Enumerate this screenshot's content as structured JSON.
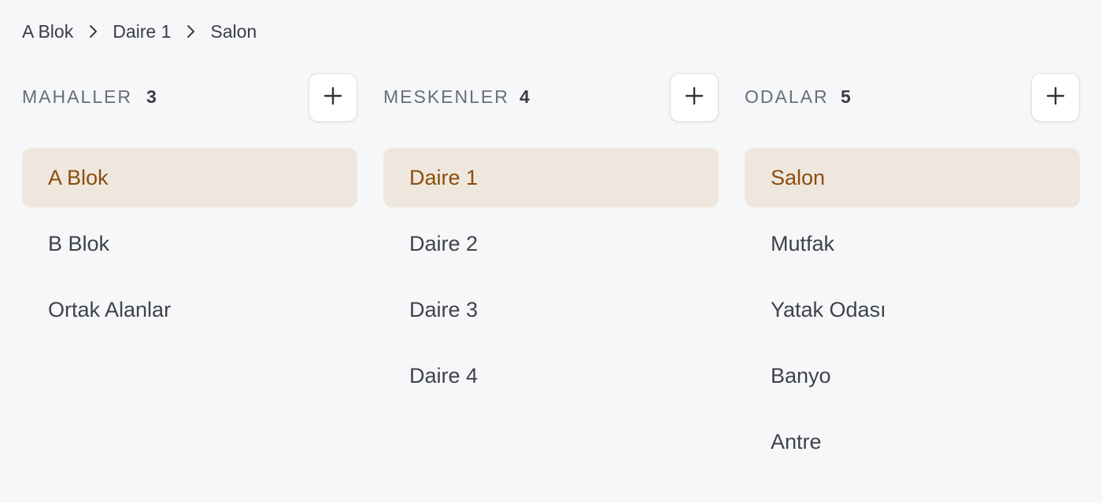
{
  "breadcrumb": [
    "A Blok",
    "Daire 1",
    "Salon"
  ],
  "columns": [
    {
      "title": "MAHALLER",
      "count": "3",
      "items": [
        "A Blok",
        "B Blok",
        "Ortak Alanlar"
      ],
      "selected_index": 0
    },
    {
      "title": "MESKENLER",
      "count": "4",
      "items": [
        "Daire 1",
        "Daire 2",
        "Daire 3",
        "Daire 4"
      ],
      "selected_index": 0
    },
    {
      "title": "ODALAR",
      "count": "5",
      "items": [
        "Salon",
        "Mutfak",
        "Yatak Odası",
        "Banyo",
        "Antre"
      ],
      "selected_index": 0
    }
  ],
  "icons": {
    "breadcrumb_separator": "chevron-right-icon",
    "add_button": "plus-icon"
  },
  "colors": {
    "background": "#f5f7f9",
    "selected_background": "#efe7de",
    "selected_text": "#8a4d0e",
    "header_text": "#6a6e75",
    "item_text": "#3f4247"
  }
}
